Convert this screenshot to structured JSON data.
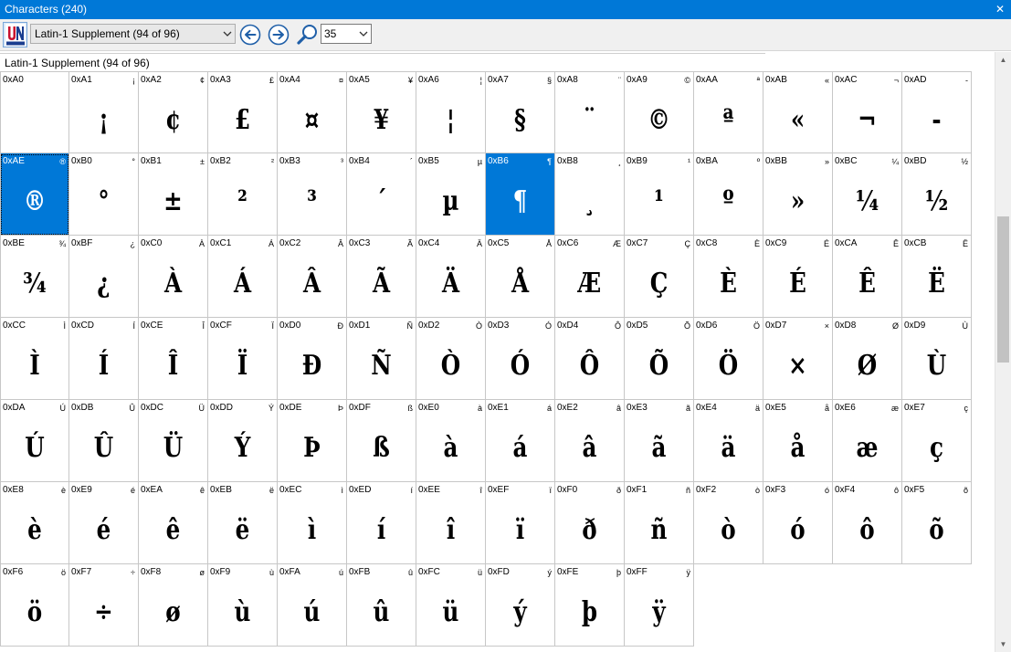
{
  "window": {
    "title": "Characters (240)"
  },
  "toolbar": {
    "block_selected": "Latin-1 Supplement (94 of 96)",
    "font_size_value": "35"
  },
  "group": {
    "label": "Latin-1 Supplement (94 of 96)"
  },
  "colors": {
    "title_bar": "#0078d7",
    "selection": "#0078d7"
  },
  "characters": [
    {
      "code": "0xA0",
      "char": " "
    },
    {
      "code": "0xA1",
      "char": "¡"
    },
    {
      "code": "0xA2",
      "char": "¢"
    },
    {
      "code": "0xA3",
      "char": "£"
    },
    {
      "code": "0xA4",
      "char": "¤"
    },
    {
      "code": "0xA5",
      "char": "¥"
    },
    {
      "code": "0xA6",
      "char": "¦"
    },
    {
      "code": "0xA7",
      "char": "§"
    },
    {
      "code": "0xA8",
      "char": "¨"
    },
    {
      "code": "0xA9",
      "char": "©"
    },
    {
      "code": "0xAA",
      "char": "ª"
    },
    {
      "code": "0xAB",
      "char": "«"
    },
    {
      "code": "0xAC",
      "char": "¬"
    },
    {
      "code": "0xAD",
      "char": "-"
    },
    {
      "code": "0xAE",
      "char": "®"
    },
    {
      "code": "0xB0",
      "char": "°"
    },
    {
      "code": "0xB1",
      "char": "±"
    },
    {
      "code": "0xB2",
      "char": "²"
    },
    {
      "code": "0xB3",
      "char": "³"
    },
    {
      "code": "0xB4",
      "char": "´"
    },
    {
      "code": "0xB5",
      "char": "µ"
    },
    {
      "code": "0xB6",
      "char": "¶"
    },
    {
      "code": "0xB8",
      "char": "¸"
    },
    {
      "code": "0xB9",
      "char": "¹"
    },
    {
      "code": "0xBA",
      "char": "º"
    },
    {
      "code": "0xBB",
      "char": "»"
    },
    {
      "code": "0xBC",
      "char": "¼"
    },
    {
      "code": "0xBD",
      "char": "½"
    },
    {
      "code": "0xBE",
      "char": "¾"
    },
    {
      "code": "0xBF",
      "char": "¿"
    },
    {
      "code": "0xC0",
      "char": "À"
    },
    {
      "code": "0xC1",
      "char": "Á"
    },
    {
      "code": "0xC2",
      "char": "Â"
    },
    {
      "code": "0xC3",
      "char": "Ã"
    },
    {
      "code": "0xC4",
      "char": "Ä"
    },
    {
      "code": "0xC5",
      "char": "Å"
    },
    {
      "code": "0xC6",
      "char": "Æ"
    },
    {
      "code": "0xC7",
      "char": "Ç"
    },
    {
      "code": "0xC8",
      "char": "È"
    },
    {
      "code": "0xC9",
      "char": "É"
    },
    {
      "code": "0xCA",
      "char": "Ê"
    },
    {
      "code": "0xCB",
      "char": "Ë"
    },
    {
      "code": "0xCC",
      "char": "Ì"
    },
    {
      "code": "0xCD",
      "char": "Í"
    },
    {
      "code": "0xCE",
      "char": "Î"
    },
    {
      "code": "0xCF",
      "char": "Ï"
    },
    {
      "code": "0xD0",
      "char": "Ð"
    },
    {
      "code": "0xD1",
      "char": "Ñ"
    },
    {
      "code": "0xD2",
      "char": "Ò"
    },
    {
      "code": "0xD3",
      "char": "Ó"
    },
    {
      "code": "0xD4",
      "char": "Ô"
    },
    {
      "code": "0xD5",
      "char": "Õ"
    },
    {
      "code": "0xD6",
      "char": "Ö"
    },
    {
      "code": "0xD7",
      "char": "×"
    },
    {
      "code": "0xD8",
      "char": "Ø"
    },
    {
      "code": "0xD9",
      "char": "Ù"
    },
    {
      "code": "0xDA",
      "char": "Ú"
    },
    {
      "code": "0xDB",
      "char": "Û"
    },
    {
      "code": "0xDC",
      "char": "Ü"
    },
    {
      "code": "0xDD",
      "char": "Ý"
    },
    {
      "code": "0xDE",
      "char": "Þ"
    },
    {
      "code": "0xDF",
      "char": "ß"
    },
    {
      "code": "0xE0",
      "char": "à"
    },
    {
      "code": "0xE1",
      "char": "á"
    },
    {
      "code": "0xE2",
      "char": "â"
    },
    {
      "code": "0xE3",
      "char": "ã"
    },
    {
      "code": "0xE4",
      "char": "ä"
    },
    {
      "code": "0xE5",
      "char": "å"
    },
    {
      "code": "0xE6",
      "char": "æ"
    },
    {
      "code": "0xE7",
      "char": "ç"
    },
    {
      "code": "0xE8",
      "char": "è"
    },
    {
      "code": "0xE9",
      "char": "é"
    },
    {
      "code": "0xEA",
      "char": "ê"
    },
    {
      "code": "0xEB",
      "char": "ë"
    },
    {
      "code": "0xEC",
      "char": "ì"
    },
    {
      "code": "0xED",
      "char": "í"
    },
    {
      "code": "0xEE",
      "char": "î"
    },
    {
      "code": "0xEF",
      "char": "ï"
    },
    {
      "code": "0xF0",
      "char": "ð"
    },
    {
      "code": "0xF1",
      "char": "ñ"
    },
    {
      "code": "0xF2",
      "char": "ò"
    },
    {
      "code": "0xF3",
      "char": "ó"
    },
    {
      "code": "0xF4",
      "char": "ô"
    },
    {
      "code": "0xF5",
      "char": "õ"
    },
    {
      "code": "0xF6",
      "char": "ö"
    },
    {
      "code": "0xF7",
      "char": "÷"
    },
    {
      "code": "0xF8",
      "char": "ø"
    },
    {
      "code": "0xF9",
      "char": "ù"
    },
    {
      "code": "0xFA",
      "char": "ú"
    },
    {
      "code": "0xFB",
      "char": "û"
    },
    {
      "code": "0xFC",
      "char": "ü"
    },
    {
      "code": "0xFD",
      "char": "ý"
    },
    {
      "code": "0xFE",
      "char": "þ"
    },
    {
      "code": "0xFF",
      "char": "ÿ"
    }
  ],
  "selected_codes": [
    "0xAE",
    "0xB6"
  ]
}
